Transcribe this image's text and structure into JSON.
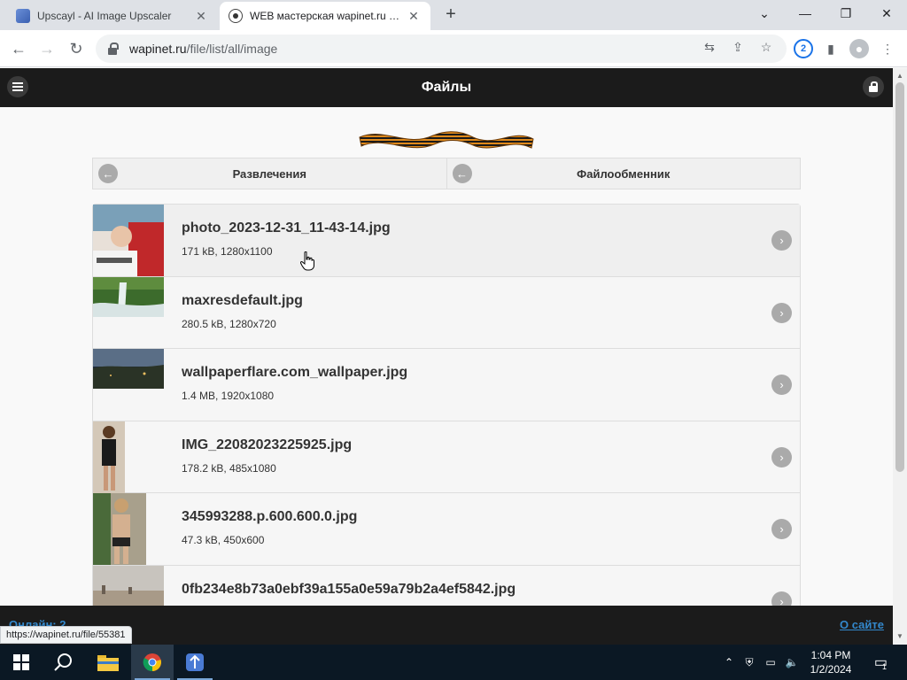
{
  "browser": {
    "tabs": [
      {
        "title": "Upscayl - AI Image Upscaler",
        "active": false
      },
      {
        "title": "WEB мастерская wapinet.ru - Фа",
        "active": true
      }
    ],
    "new_tab": "+",
    "url_host": "wapinet.ru",
    "url_path": "/file/list/all/image",
    "download_badge": "2",
    "status_url": "https://wapinet.ru/file/55381"
  },
  "page": {
    "header_title": "Файлы",
    "nav": {
      "prev_label": "Развлечения",
      "next_label": "Файлообменник"
    },
    "files": [
      {
        "name": "photo_2023-12-31_11-43-14.jpg",
        "info": "171 kB, 1280x1100"
      },
      {
        "name": "maxresdefault.jpg",
        "info": "280.5 kB, 1280x720"
      },
      {
        "name": "wallpaperflare.com_wallpaper.jpg",
        "info": "1.4 MB, 1920x1080"
      },
      {
        "name": "IMG_22082023225925.jpg",
        "info": "178.2 kB, 485x1080"
      },
      {
        "name": "345993288.p.600.600.0.jpg",
        "info": "47.3 kB, 450x600"
      },
      {
        "name": "0fb234e8b73a0ebf39a155a0e59a79b2a4ef5842.jpg",
        "info": ""
      }
    ],
    "footer": {
      "online": "Онлайн: 2",
      "about": "О сайте"
    }
  },
  "taskbar": {
    "time": "1:04 PM",
    "date": "1/2/2024",
    "notifications": "1"
  }
}
